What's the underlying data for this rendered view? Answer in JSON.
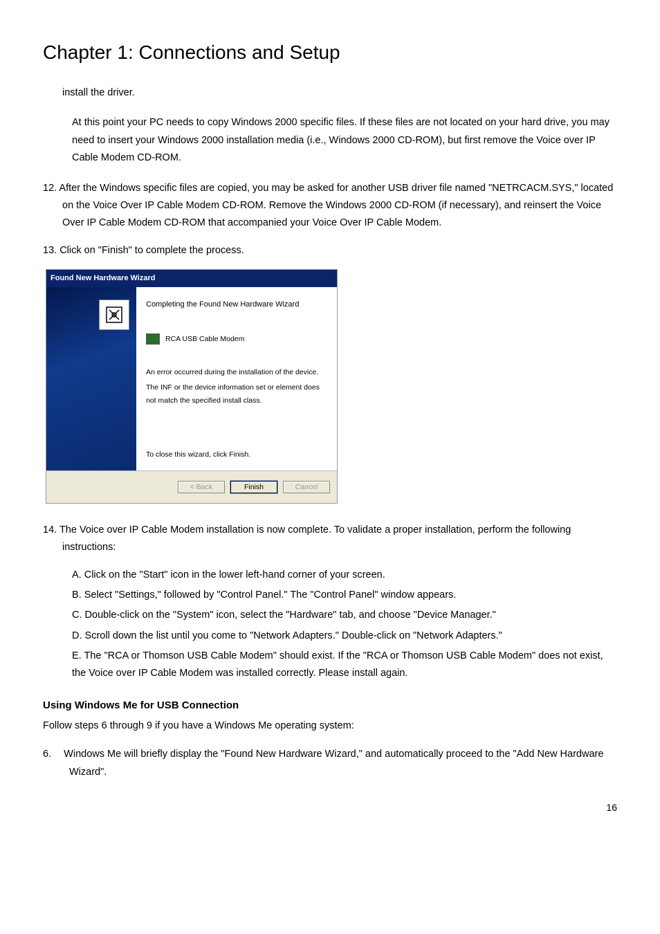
{
  "chapter_title": "Chapter 1: Connections and Setup",
  "p_install_driver": "install the driver.",
  "p_at_this_point": "At this point your PC needs to copy Windows 2000 specific files. If these files are not located on your hard drive, you may need to insert your Windows 2000 installation media (i.e., Windows 2000 CD-ROM), but first remove the Voice over IP Cable Modem CD-ROM.",
  "step12_num": "12.",
  "step12": "After the Windows specific files are copied, you may be asked for another USB driver file named \"NETRCACM.SYS,\" located on the Voice Over IP Cable Modem CD-ROM. Remove the Windows 2000 CD-ROM (if necessary), and reinsert the Voice Over IP Cable Modem CD-ROM that accompanied your Voice Over IP Cable Modem.",
  "step13_num": "13.",
  "step13": "Click on \"Finish\" to complete the process.",
  "wizard": {
    "title": "Found New Hardware Wizard",
    "heading": "Completing the Found New Hardware Wizard",
    "device": "RCA USB Cable Modem",
    "error1": "An error occurred during the installation of the device.",
    "error2": "The INF or the device information set or element does not match the specified install class.",
    "close_hint": "To close this wizard, click Finish.",
    "btn_back": "< Back",
    "btn_finish": "Finish",
    "btn_cancel": "Cancel"
  },
  "step14_num": "14.",
  "step14_intro": "The Voice over IP Cable Modem installation is now complete. To validate a proper installation, perform the following instructions:",
  "step14_a": "A. Click on the \"Start\" icon in the lower left-hand corner of your screen.",
  "step14_b": "B. Select \"Settings,\" followed by \"Control Panel.\" The \"Control Panel\" window appears.",
  "step14_c": "C. Double-click on the \"System\" icon, select the \"Hardware\" tab, and choose \"Device Manager.\"",
  "step14_d": "D. Scroll down the list until you come to \"Network Adapters.\" Double-click on \"Network Adapters.\"",
  "step14_e": "E. The \"RCA or Thomson USB Cable Modem\" should exist. If the \"RCA or Thomson USB Cable Modem\" does not exist, the Voice over IP Cable Modem was        installed correctly. Please install again.",
  "section_heading": "Using Windows Me for USB Connection",
  "section_sub": "Follow steps 6 through 9 if you have a Windows Me operating system:",
  "step6_num": "6.",
  "step6": "Windows Me will briefly display the \"Found New Hardware Wizard,\" and automatically proceed to the \"Add New Hardware Wizard\".",
  "page_number": "16"
}
